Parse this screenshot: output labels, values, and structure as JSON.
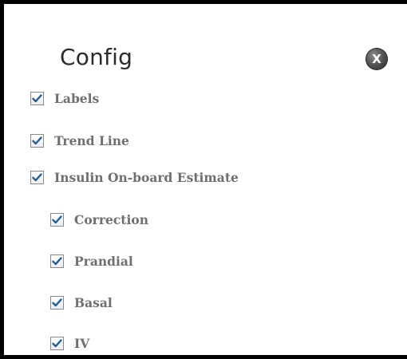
{
  "panel": {
    "title": "Config",
    "close_label": "X"
  },
  "options": {
    "labels": {
      "label": "Labels",
      "checked": true
    },
    "trend_line": {
      "label": "Trend Line",
      "checked": true
    },
    "insulin_estimate": {
      "label": "Insulin On-board Estimate",
      "checked": true
    },
    "correction": {
      "label": "Correction",
      "checked": true
    },
    "prandial": {
      "label": "Prandial",
      "checked": true
    },
    "basal": {
      "label": "Basal",
      "checked": true
    },
    "iv": {
      "label": "IV",
      "checked": true
    }
  },
  "colors": {
    "checkmark": "#1f5d99",
    "label_text": "#6f6f6f",
    "title_text": "#2b2b2b",
    "close_button": "#4a4a4a"
  }
}
